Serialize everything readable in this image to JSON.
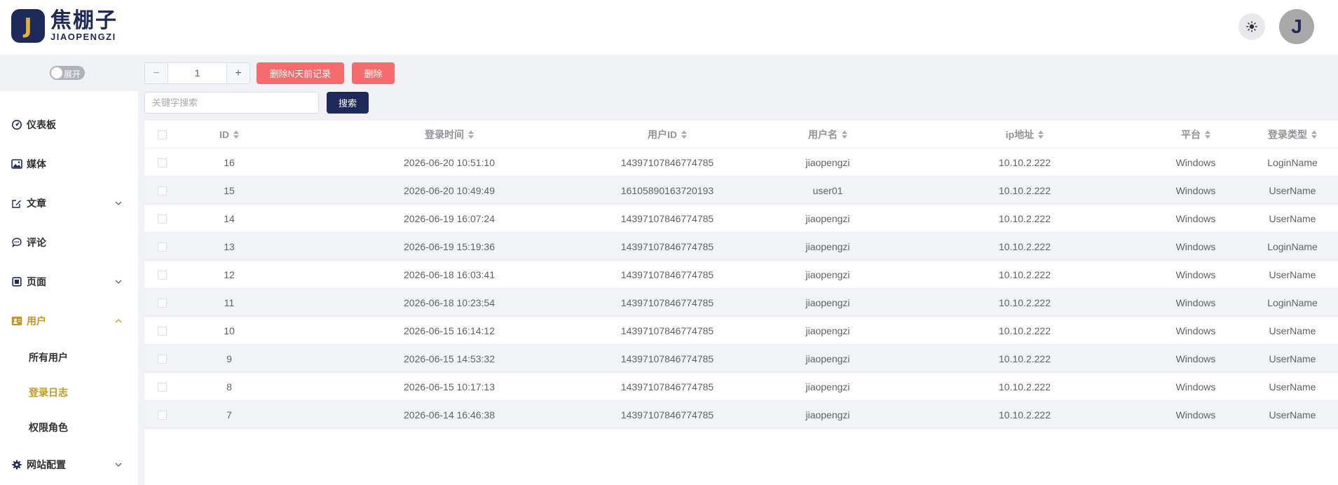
{
  "header": {
    "logo_letter": "J",
    "logo_cn": "焦棚子",
    "logo_en": "JIAOPENGZI",
    "avatar_letter": "J",
    "theme_icon": "sun-icon"
  },
  "sidebar": {
    "toggle_label": "展开",
    "items": [
      {
        "label": "仪表板",
        "icon": "dashboard-icon"
      },
      {
        "label": "媒体",
        "icon": "image-icon"
      },
      {
        "label": "文章",
        "icon": "edit-icon"
      },
      {
        "label": "评论",
        "icon": "comment-icon"
      },
      {
        "label": "页面",
        "icon": "page-icon"
      },
      {
        "label": "用户",
        "icon": "user-icon"
      },
      {
        "label": "网站配置",
        "icon": "gear-icon"
      }
    ],
    "sub_items": [
      {
        "label": "所有用户"
      },
      {
        "label": "登录日志"
      },
      {
        "label": "权限角色"
      }
    ],
    "active_item": "用户",
    "active_sub_item": "登录日志"
  },
  "toolbar": {
    "stepper_value": "1",
    "minus_label": "−",
    "plus_label": "+",
    "delete_days_label": "删除N天前记录",
    "delete_label": "删除",
    "search_placeholder": "关键字搜索",
    "search_label": "搜索",
    "accent_color": "#f56c6c",
    "primary_color": "#1e2a5a"
  },
  "table": {
    "columns": [
      "ID",
      "登录时间",
      "用户ID",
      "用户名",
      "ip地址",
      "平台",
      "登录类型"
    ],
    "rows": [
      {
        "id": "16",
        "time": "2026-06-20 10:51:10",
        "uid": "14397107846774785",
        "name": "jiaopengzi",
        "ip": "10.10.2.222",
        "platform": "Windows",
        "type": "LoginName"
      },
      {
        "id": "15",
        "time": "2026-06-20 10:49:49",
        "uid": "16105890163720193",
        "name": "user01",
        "ip": "10.10.2.222",
        "platform": "Windows",
        "type": "UserName"
      },
      {
        "id": "14",
        "time": "2026-06-19 16:07:24",
        "uid": "14397107846774785",
        "name": "jiaopengzi",
        "ip": "10.10.2.222",
        "platform": "Windows",
        "type": "UserName"
      },
      {
        "id": "13",
        "time": "2026-06-19 15:19:36",
        "uid": "14397107846774785",
        "name": "jiaopengzi",
        "ip": "10.10.2.222",
        "platform": "Windows",
        "type": "LoginName"
      },
      {
        "id": "12",
        "time": "2026-06-18 16:03:41",
        "uid": "14397107846774785",
        "name": "jiaopengzi",
        "ip": "10.10.2.222",
        "platform": "Windows",
        "type": "UserName"
      },
      {
        "id": "11",
        "time": "2026-06-18 10:23:54",
        "uid": "14397107846774785",
        "name": "jiaopengzi",
        "ip": "10.10.2.222",
        "platform": "Windows",
        "type": "LoginName"
      },
      {
        "id": "10",
        "time": "2026-06-15 16:14:12",
        "uid": "14397107846774785",
        "name": "jiaopengzi",
        "ip": "10.10.2.222",
        "platform": "Windows",
        "type": "UserName"
      },
      {
        "id": "9",
        "time": "2026-06-15 14:53:32",
        "uid": "14397107846774785",
        "name": "jiaopengzi",
        "ip": "10.10.2.222",
        "platform": "Windows",
        "type": "UserName"
      },
      {
        "id": "8",
        "time": "2026-06-15 10:17:13",
        "uid": "14397107846774785",
        "name": "jiaopengzi",
        "ip": "10.10.2.222",
        "platform": "Windows",
        "type": "UserName"
      },
      {
        "id": "7",
        "time": "2026-06-14 16:46:38",
        "uid": "14397107846774785",
        "name": "jiaopengzi",
        "ip": "10.10.2.222",
        "platform": "Windows",
        "type": "UserName"
      }
    ]
  }
}
